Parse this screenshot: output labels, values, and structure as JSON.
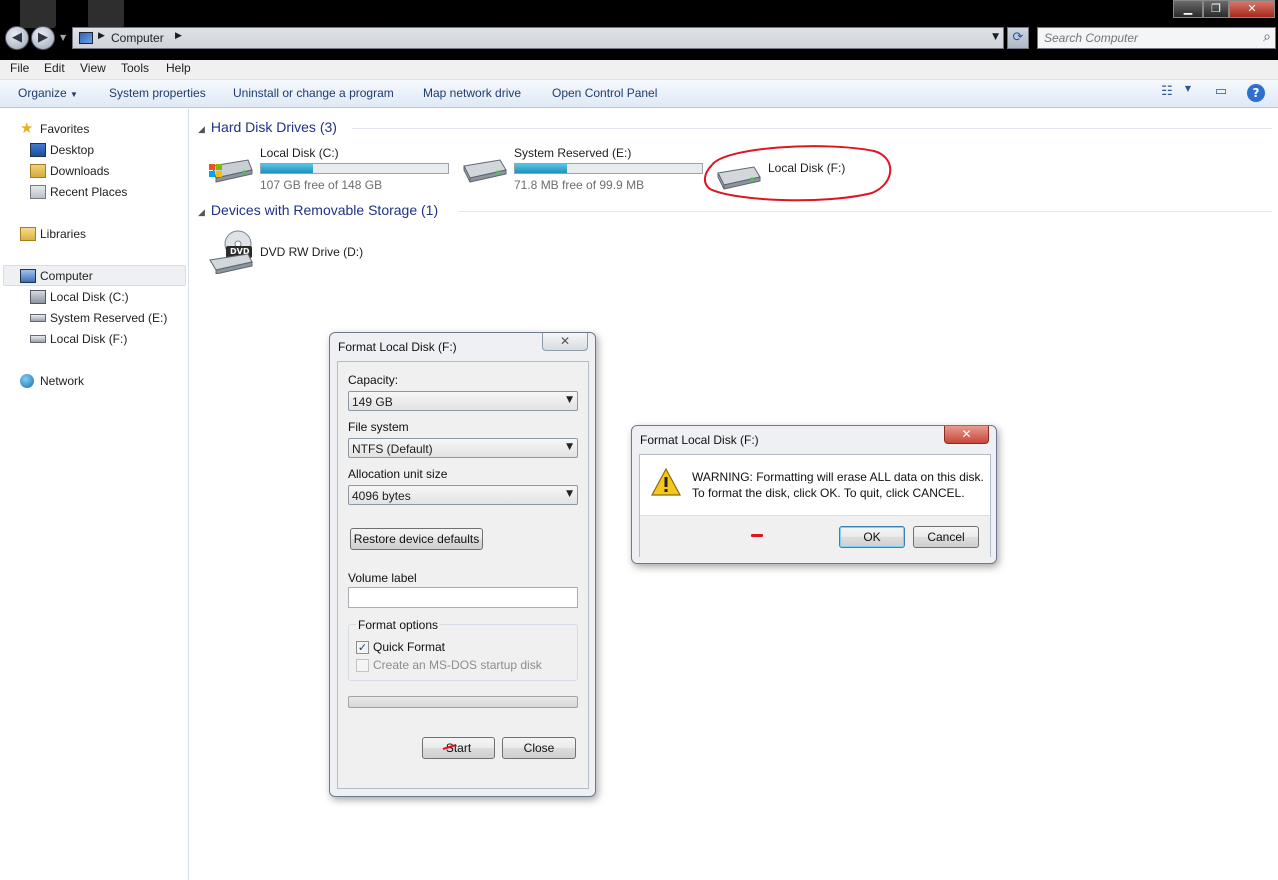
{
  "window": {
    "address_crumb": "Computer",
    "search_placeholder": "Search Computer"
  },
  "menu": [
    "File",
    "Edit",
    "View",
    "Tools",
    "Help"
  ],
  "commands": {
    "organize": "Organize",
    "system_properties": "System properties",
    "uninstall": "Uninstall or change a program",
    "map_drive": "Map network drive",
    "control_panel": "Open Control Panel"
  },
  "nav": {
    "favorites": "Favorites",
    "desktop": "Desktop",
    "downloads": "Downloads",
    "recent": "Recent Places",
    "libraries": "Libraries",
    "computer": "Computer",
    "local_c": "Local Disk (C:)",
    "system_e": "System Reserved (E:)",
    "local_f": "Local Disk (F:)",
    "network": "Network"
  },
  "groups": {
    "hard_disks": "Hard Disk Drives (3)",
    "removable": "Devices with Removable Storage (1)"
  },
  "drives": [
    {
      "name": "Local Disk (C:)",
      "free": "107 GB free of 148 GB",
      "used_fraction": 0.28
    },
    {
      "name": "System Reserved (E:)",
      "free": "71.8 MB free of 99.9 MB",
      "used_fraction": 0.28
    },
    {
      "name": "Local Disk (F:)"
    }
  ],
  "removable": [
    {
      "name": "DVD RW Drive (D:)",
      "badge": "DVD"
    }
  ],
  "format_dialog": {
    "title": "Format Local Disk (F:)",
    "close_glyph": "✕",
    "capacity_label": "Capacity:",
    "capacity_value": "149 GB",
    "fs_label": "File system",
    "fs_value": "NTFS (Default)",
    "alloc_label": "Allocation unit size",
    "alloc_value": "4096 bytes",
    "restore_btn": "Restore device defaults",
    "volume_label": "Volume label",
    "volume_value": "",
    "options_label": "Format options",
    "quick_format": "Quick Format",
    "quick_format_checked": true,
    "msdos": "Create an MS-DOS startup disk",
    "msdos_checked": false,
    "progress": 0,
    "start_btn": "Start",
    "close_btn": "Close"
  },
  "warning_dialog": {
    "title": "Format Local Disk (F:)",
    "close_glyph": "✕",
    "line1": "WARNING: Formatting will erase ALL data on this disk.",
    "line2": "To format the disk, click OK. To quit, click CANCEL.",
    "ok_btn": "OK",
    "cancel_btn": "Cancel"
  },
  "colors": {
    "annotation_red": "#e0141e",
    "progress_fill": "#1f8fbd",
    "close_red": "#c7483a"
  }
}
